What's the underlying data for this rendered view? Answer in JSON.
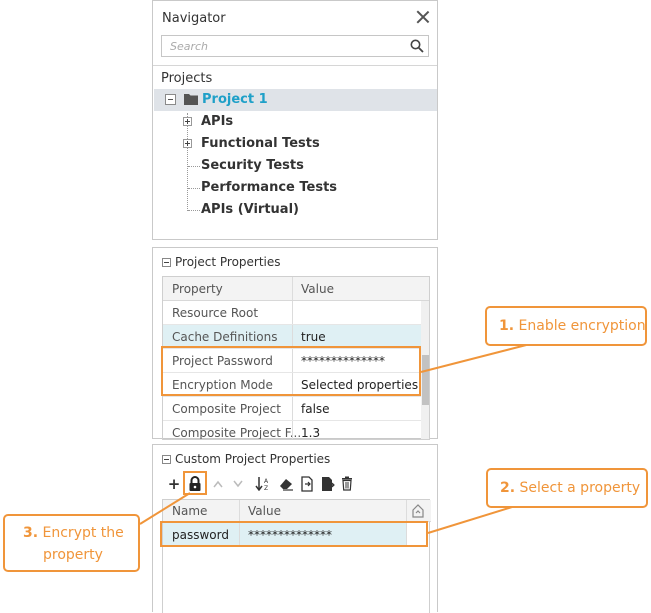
{
  "navigator": {
    "title": "Navigator",
    "search_placeholder": "Search",
    "projects_label": "Projects",
    "project_name": "Project 1",
    "tree_items": [
      "APIs",
      "Functional Tests",
      "Security Tests",
      "Performance Tests",
      "APIs (Virtual)"
    ]
  },
  "project_properties": {
    "title": "Project Properties",
    "columns": [
      "Property",
      "Value"
    ],
    "rows": [
      {
        "name": "Resource Root",
        "value": ""
      },
      {
        "name": "Cache Definitions",
        "value": "true"
      },
      {
        "name": "Project Password",
        "value": "**************"
      },
      {
        "name": "Encryption Mode",
        "value": "Selected properties"
      },
      {
        "name": "Composite Project",
        "value": "false"
      },
      {
        "name": "Composite Project F...",
        "value": "1.3"
      }
    ]
  },
  "custom_properties": {
    "title": "Custom Project Properties",
    "columns": [
      "Name",
      "Value"
    ],
    "rows": [
      {
        "name": "password",
        "value": "**************"
      }
    ]
  },
  "callouts": {
    "c1_num": "1.",
    "c1_text": "Enable encryption",
    "c2_num": "2.",
    "c2_text": "Select a property",
    "c3_num": "3.",
    "c3_line1": "Encrypt the",
    "c3_line2": "property"
  },
  "colors": {
    "accent_orange": "#f0953a",
    "project_blue": "#1fa0c8",
    "row_highlight": "#dff0f4",
    "selected_row": "#dfe3e8"
  }
}
